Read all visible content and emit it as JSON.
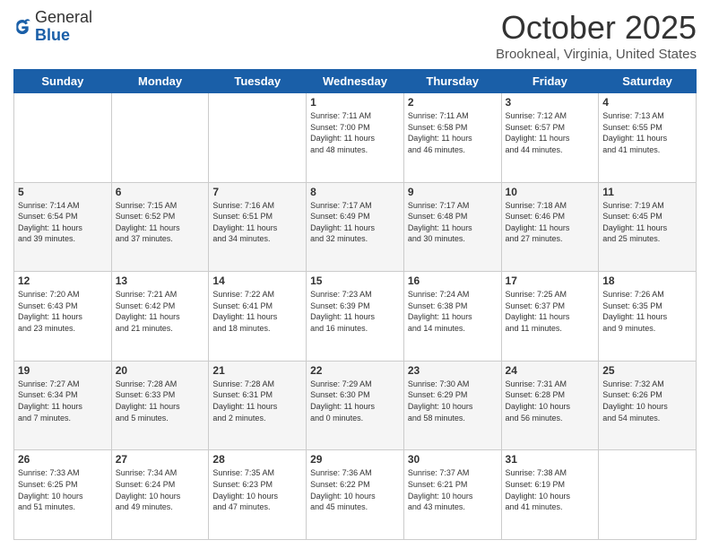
{
  "logo": {
    "general": "General",
    "blue": "Blue"
  },
  "header": {
    "month": "October 2025",
    "location": "Brookneal, Virginia, United States"
  },
  "weekdays": [
    "Sunday",
    "Monday",
    "Tuesday",
    "Wednesday",
    "Thursday",
    "Friday",
    "Saturday"
  ],
  "weeks": [
    [
      {
        "day": "",
        "info": ""
      },
      {
        "day": "",
        "info": ""
      },
      {
        "day": "",
        "info": ""
      },
      {
        "day": "1",
        "info": "Sunrise: 7:11 AM\nSunset: 7:00 PM\nDaylight: 11 hours\nand 48 minutes."
      },
      {
        "day": "2",
        "info": "Sunrise: 7:11 AM\nSunset: 6:58 PM\nDaylight: 11 hours\nand 46 minutes."
      },
      {
        "day": "3",
        "info": "Sunrise: 7:12 AM\nSunset: 6:57 PM\nDaylight: 11 hours\nand 44 minutes."
      },
      {
        "day": "4",
        "info": "Sunrise: 7:13 AM\nSunset: 6:55 PM\nDaylight: 11 hours\nand 41 minutes."
      }
    ],
    [
      {
        "day": "5",
        "info": "Sunrise: 7:14 AM\nSunset: 6:54 PM\nDaylight: 11 hours\nand 39 minutes."
      },
      {
        "day": "6",
        "info": "Sunrise: 7:15 AM\nSunset: 6:52 PM\nDaylight: 11 hours\nand 37 minutes."
      },
      {
        "day": "7",
        "info": "Sunrise: 7:16 AM\nSunset: 6:51 PM\nDaylight: 11 hours\nand 34 minutes."
      },
      {
        "day": "8",
        "info": "Sunrise: 7:17 AM\nSunset: 6:49 PM\nDaylight: 11 hours\nand 32 minutes."
      },
      {
        "day": "9",
        "info": "Sunrise: 7:17 AM\nSunset: 6:48 PM\nDaylight: 11 hours\nand 30 minutes."
      },
      {
        "day": "10",
        "info": "Sunrise: 7:18 AM\nSunset: 6:46 PM\nDaylight: 11 hours\nand 27 minutes."
      },
      {
        "day": "11",
        "info": "Sunrise: 7:19 AM\nSunset: 6:45 PM\nDaylight: 11 hours\nand 25 minutes."
      }
    ],
    [
      {
        "day": "12",
        "info": "Sunrise: 7:20 AM\nSunset: 6:43 PM\nDaylight: 11 hours\nand 23 minutes."
      },
      {
        "day": "13",
        "info": "Sunrise: 7:21 AM\nSunset: 6:42 PM\nDaylight: 11 hours\nand 21 minutes."
      },
      {
        "day": "14",
        "info": "Sunrise: 7:22 AM\nSunset: 6:41 PM\nDaylight: 11 hours\nand 18 minutes."
      },
      {
        "day": "15",
        "info": "Sunrise: 7:23 AM\nSunset: 6:39 PM\nDaylight: 11 hours\nand 16 minutes."
      },
      {
        "day": "16",
        "info": "Sunrise: 7:24 AM\nSunset: 6:38 PM\nDaylight: 11 hours\nand 14 minutes."
      },
      {
        "day": "17",
        "info": "Sunrise: 7:25 AM\nSunset: 6:37 PM\nDaylight: 11 hours\nand 11 minutes."
      },
      {
        "day": "18",
        "info": "Sunrise: 7:26 AM\nSunset: 6:35 PM\nDaylight: 11 hours\nand 9 minutes."
      }
    ],
    [
      {
        "day": "19",
        "info": "Sunrise: 7:27 AM\nSunset: 6:34 PM\nDaylight: 11 hours\nand 7 minutes."
      },
      {
        "day": "20",
        "info": "Sunrise: 7:28 AM\nSunset: 6:33 PM\nDaylight: 11 hours\nand 5 minutes."
      },
      {
        "day": "21",
        "info": "Sunrise: 7:28 AM\nSunset: 6:31 PM\nDaylight: 11 hours\nand 2 minutes."
      },
      {
        "day": "22",
        "info": "Sunrise: 7:29 AM\nSunset: 6:30 PM\nDaylight: 11 hours\nand 0 minutes."
      },
      {
        "day": "23",
        "info": "Sunrise: 7:30 AM\nSunset: 6:29 PM\nDaylight: 10 hours\nand 58 minutes."
      },
      {
        "day": "24",
        "info": "Sunrise: 7:31 AM\nSunset: 6:28 PM\nDaylight: 10 hours\nand 56 minutes."
      },
      {
        "day": "25",
        "info": "Sunrise: 7:32 AM\nSunset: 6:26 PM\nDaylight: 10 hours\nand 54 minutes."
      }
    ],
    [
      {
        "day": "26",
        "info": "Sunrise: 7:33 AM\nSunset: 6:25 PM\nDaylight: 10 hours\nand 51 minutes."
      },
      {
        "day": "27",
        "info": "Sunrise: 7:34 AM\nSunset: 6:24 PM\nDaylight: 10 hours\nand 49 minutes."
      },
      {
        "day": "28",
        "info": "Sunrise: 7:35 AM\nSunset: 6:23 PM\nDaylight: 10 hours\nand 47 minutes."
      },
      {
        "day": "29",
        "info": "Sunrise: 7:36 AM\nSunset: 6:22 PM\nDaylight: 10 hours\nand 45 minutes."
      },
      {
        "day": "30",
        "info": "Sunrise: 7:37 AM\nSunset: 6:21 PM\nDaylight: 10 hours\nand 43 minutes."
      },
      {
        "day": "31",
        "info": "Sunrise: 7:38 AM\nSunset: 6:19 PM\nDaylight: 10 hours\nand 41 minutes."
      },
      {
        "day": "",
        "info": ""
      }
    ]
  ]
}
